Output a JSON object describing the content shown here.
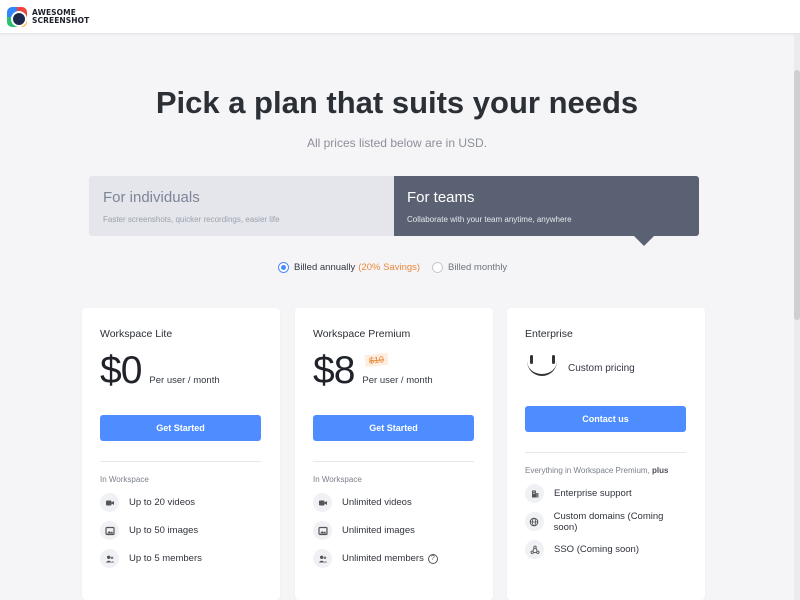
{
  "app": {
    "logo_line1": "AWESOME",
    "logo_line2": "SCREENSHOT"
  },
  "header": {
    "title": "Pick a plan that suits your needs",
    "subtitle": "All prices listed below are in USD."
  },
  "audience_toggle": {
    "individuals": {
      "title": "For individuals",
      "desc": "Faster screenshots, quicker recordings, easier life"
    },
    "teams": {
      "title": "For teams",
      "desc": "Collaborate with your team anytime, anywhere"
    },
    "selected": "teams"
  },
  "billing": {
    "annual_label": "Billed annually",
    "annual_savings": "(20% Savings)",
    "monthly_label": "Billed monthly",
    "selected": "annual",
    "accent": "#4a8cff",
    "savings_color": "#e8893a"
  },
  "plans": [
    {
      "name": "Workspace Lite",
      "price": "$0",
      "per": "Per user / month",
      "cta": "Get Started",
      "group_label": "In Workspace",
      "features": [
        {
          "icon": "video-icon",
          "text": "Up to 20 videos"
        },
        {
          "icon": "image-icon",
          "text": "Up to 50 images"
        },
        {
          "icon": "members-icon",
          "text": "Up to 5 members"
        }
      ]
    },
    {
      "name": "Workspace Premium",
      "price": "$8",
      "original_price": "$10",
      "per": "Per user / month",
      "cta": "Get Started",
      "group_label": "In Workspace",
      "features": [
        {
          "icon": "video-icon",
          "text": "Unlimited videos"
        },
        {
          "icon": "image-icon",
          "text": "Unlimited images"
        },
        {
          "icon": "members-icon",
          "text": "Unlimited members",
          "help": "?"
        }
      ]
    },
    {
      "name": "Enterprise",
      "custom_pricing": "Custom pricing",
      "cta": "Contact us",
      "group_label": "Everything in Workspace Premium,",
      "group_label_emph": "plus",
      "features": [
        {
          "icon": "building-icon",
          "text": "Enterprise support"
        },
        {
          "icon": "globe-icon",
          "text": "Custom domains (Coming soon)"
        },
        {
          "icon": "sso-icon",
          "text": "SSO (Coming soon)"
        }
      ]
    }
  ],
  "colors": {
    "cta": "#4e8dff",
    "teams_bg": "#5a6172",
    "individuals_bg": "#e4e6ec"
  }
}
